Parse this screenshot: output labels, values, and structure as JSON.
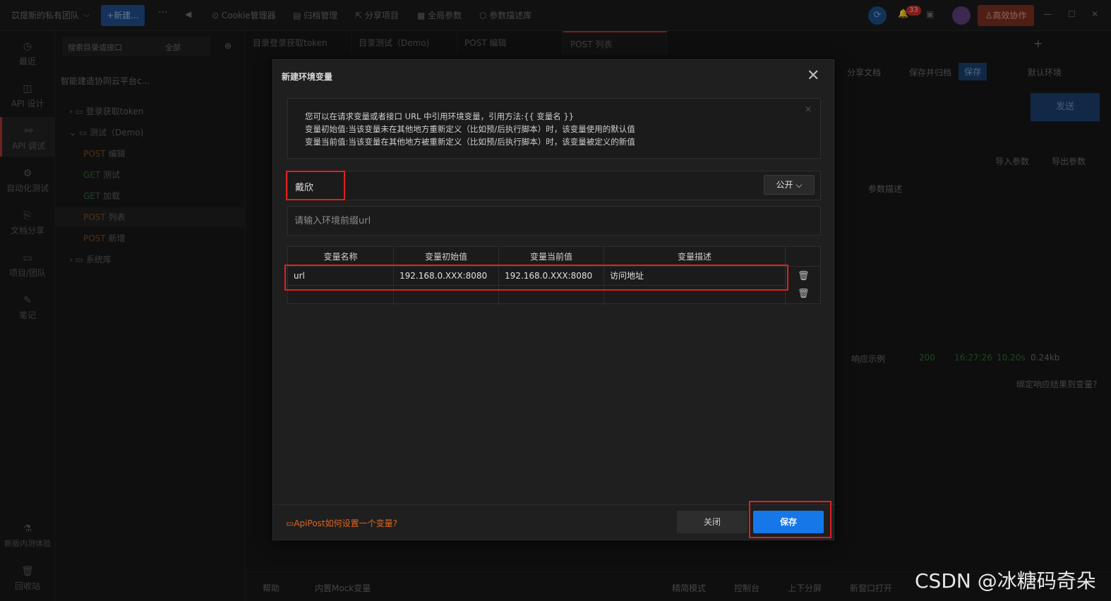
{
  "topbar": {
    "team": "苡提斯的私有团队",
    "new_button": "+新建...",
    "more": "···",
    "items": [
      "Cookie管理器",
      "归档管理",
      "分享项目",
      "全局参数",
      "参数描述库"
    ],
    "notification_count": "33",
    "collab_button": "高效协作"
  },
  "rail": {
    "items": [
      "最近",
      "API 设计",
      "API 调试",
      "自动化测试",
      "文档分享",
      "项目/团队",
      "笔记",
      "新版内测体验",
      "回收站"
    ]
  },
  "tree": {
    "search_placeholder": "搜索目录或接口",
    "filter": "全部",
    "project": "智能建造协同云平台c...",
    "rows": [
      {
        "label": "登录获取token",
        "method": ""
      },
      {
        "label": "测试（Demo)",
        "method": ""
      },
      {
        "label": "编辑",
        "method": "POST"
      },
      {
        "label": "测试",
        "method": "GET"
      },
      {
        "label": "加载",
        "method": "GET"
      },
      {
        "label": "列表",
        "method": "POST"
      },
      {
        "label": "新增",
        "method": "POST"
      },
      {
        "label": "系统库",
        "method": ""
      }
    ]
  },
  "tabs": [
    "目录登录获取token",
    "目录测试（Demo)",
    "POST 编辑",
    "POST 列表"
  ],
  "toolbar": {
    "share_doc": "分享文档",
    "save_archive": "保存并归档",
    "save": "保存",
    "env": "默认环境",
    "send": "发送",
    "import_params": "导入参数",
    "export_params": "导出参数",
    "param_desc": "参数描述"
  },
  "response": {
    "example": "响应示例",
    "status": "200",
    "time": "16:27:26",
    "duration": "10.20s",
    "size": "0.24kb",
    "bind": "绑定响应结果到变量?"
  },
  "bottombar": {
    "help": "帮助",
    "mock": "内置Mock变量",
    "simple_mode": "精简模式",
    "console": "控制台",
    "split": "上下分屏",
    "new_window": "新窗口打开"
  },
  "modal": {
    "title": "新建环境变量",
    "info_lines": [
      "您可以在请求变量或者接口 URL 中引用环境变量，引用方法:{{ 变量名 }}",
      "变量初始值:当该变量未在其他地方重新定义（比如预/后执行脚本）时，该变量使用的默认值",
      "变量当前值:当该变量在其他地方被重新定义（比如预/后执行脚本）时，该变量被定义的新值"
    ],
    "env_name": "戴欣",
    "visibility": "公开",
    "url_placeholder": "请输入环境前缀url",
    "table": {
      "headers": [
        "变量名称",
        "变量初始值",
        "变量当前值",
        "变量描述"
      ],
      "rows": [
        {
          "name": "url",
          "initial": "192.168.0.XXX:8080",
          "current": "192.168.0.XXX:8080",
          "desc": "访问地址"
        }
      ]
    },
    "help_link": "ApiPost如何设置一个变量?",
    "close_button": "关闭",
    "save_button": "保存"
  },
  "watermark": "CSDN @冰糖码奇朵",
  "colors": {
    "accent": "#1677e8",
    "highlight": "#e02020",
    "link": "#e0651f"
  }
}
